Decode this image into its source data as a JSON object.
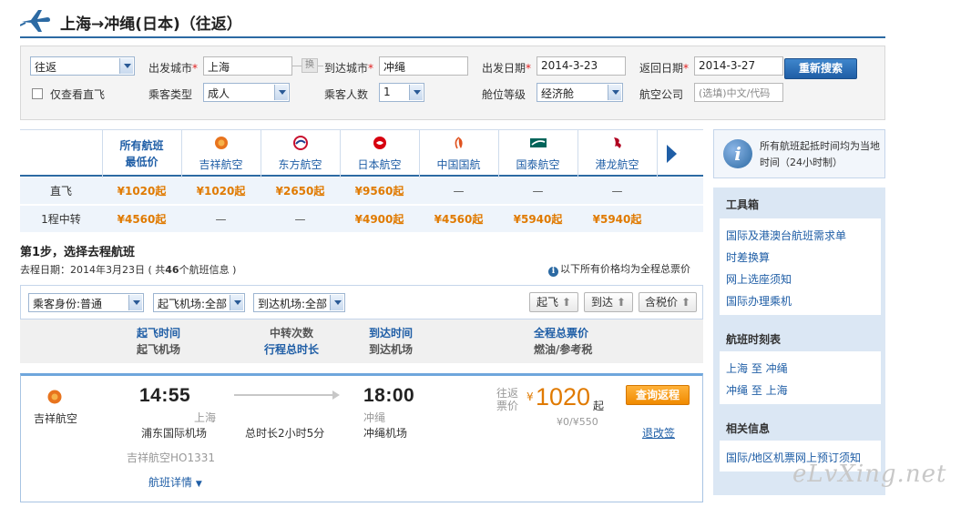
{
  "page": {
    "title": "上海→冲绳(日本)（往返）"
  },
  "search": {
    "trip_type": "往返",
    "depart_city_label": "出发城市",
    "depart_city": "上海",
    "swap_label": "换",
    "arrive_city_label": "到达城市",
    "arrive_city": "冲绳",
    "depart_date_label": "出发日期",
    "depart_date": "2014-3-23",
    "return_date_label": "返回日期",
    "return_date": "2014-3-27",
    "search_button": "重新搜索",
    "direct_only_label": "仅查看直飞",
    "passenger_type_label": "乘客类型",
    "passenger_type": "成人",
    "passenger_count_label": "乘客人数",
    "passenger_count": "1",
    "cabin_label": "舱位等级",
    "cabin": "经济舱",
    "airline_label": "航空公司",
    "airline_placeholder": "(选填)中文/代码"
  },
  "matrix": {
    "all_label_1": "所有航班",
    "all_label_2": "最低价",
    "airlines": [
      {
        "name": "吉祥航空",
        "logo": "juneyao-logo",
        "color": "#e8741e"
      },
      {
        "name": "东方航空",
        "logo": "china-eastern-logo",
        "color": "#c8102e"
      },
      {
        "name": "日本航空",
        "logo": "jal-logo",
        "color": "#d7000f"
      },
      {
        "name": "中国国航",
        "logo": "air-china-logo",
        "color": "#e0521f"
      },
      {
        "name": "国泰航空",
        "logo": "cathay-logo",
        "color": "#00645a"
      },
      {
        "name": "港龙航空",
        "logo": "dragonair-logo",
        "color": "#b00020"
      }
    ],
    "rows": [
      {
        "label": "直飞",
        "all": "¥1020起",
        "prices": [
          "¥1020起",
          "¥2650起",
          "¥9560起",
          "—",
          "—",
          "—"
        ]
      },
      {
        "label": "1程中转",
        "all": "¥4560起",
        "prices": [
          "—",
          "—",
          "¥4900起",
          "¥4560起",
          "¥5940起",
          "¥5940起"
        ]
      }
    ]
  },
  "step": {
    "title": "第1步，选择去程航班",
    "date_prefix": "去程日期：2014年3月23日 ( 共",
    "count": "46",
    "date_suffix": "个航班信息 )",
    "price_note": "以下所有价格均为全程总票价"
  },
  "filters": {
    "passenger": "乘客身份:普通",
    "depart_airport": "起飞机场:全部",
    "arrive_airport": "到达机场:全部",
    "sort_depart": "起飞",
    "sort_arrive": "到达",
    "sort_price": "含税价"
  },
  "columns": {
    "depart_time": "起飞时间",
    "depart_airport": "起飞机场",
    "transfers": "中转次数",
    "duration": "行程总时长",
    "arrive_time": "到达时间",
    "arrive_airport": "到达机场",
    "total_price": "全程总票价",
    "fuel_tax": "燃油/参考税"
  },
  "flight": {
    "airline": "吉祥航空",
    "depart_time": "14:55",
    "depart_city": "上海",
    "depart_airport": "浦东国际机场",
    "flight_no": "吉祥航空HO1331",
    "details_link": "航班详情",
    "duration": "总时长2小时5分",
    "arrive_time": "18:00",
    "arrive_city": "冲绳",
    "arrive_airport": "冲绳机场",
    "price_label_1": "往返",
    "price_label_2": "票价",
    "currency": "¥",
    "price": "1020",
    "price_suffix": "起",
    "tax": "¥0/¥550",
    "query_return_button": "查询返程",
    "refund_link": "退改签"
  },
  "sidebar": {
    "tz_notice": "所有航班起抵时间均为当地时间（24小时制）",
    "tools_title": "工具箱",
    "tools": [
      "国际及港澳台航班需求单",
      "时差换算",
      "网上选座须知",
      "国际办理乘机"
    ],
    "schedule_title": "航班时刻表",
    "schedule": [
      "上海 至 冲绳",
      "冲绳 至 上海"
    ],
    "related_title": "相关信息",
    "related": [
      "国际/地区机票网上预订须知"
    ]
  },
  "watermark": "eLvXing.net"
}
